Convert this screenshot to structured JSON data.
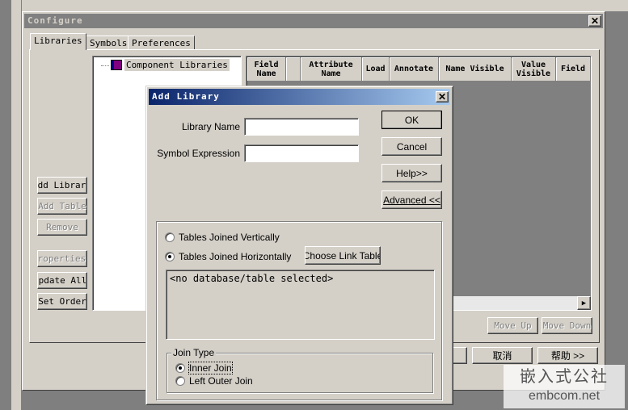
{
  "configure": {
    "title": "Configure",
    "close_glyph": "✕",
    "tabs": [
      "Libraries",
      "Symbols",
      "Preferences"
    ],
    "tree_root": "Component Libraries",
    "left_buttons": [
      "Add Library",
      "Add Table",
      "Remove",
      "Properties",
      "Update All",
      "Set Order"
    ],
    "columns": [
      "Field Name",
      "Attribute Name",
      "Load",
      "Annotate",
      "Name Visible",
      "Value Visible",
      "Field"
    ],
    "move_up": "Move Up",
    "move_down": "Move Down",
    "bottom_buttons": [
      "取消",
      "帮助 >>"
    ],
    "scroll_right_glyph": "▶"
  },
  "add_library": {
    "title": "Add Library",
    "close_glyph": "✕",
    "library_name_label": "Library Name",
    "library_name_value": "",
    "symbol_expression_label": "Symbol Expression",
    "symbol_expression_value": "",
    "ok": "OK",
    "cancel": "Cancel",
    "help": "Help>>",
    "advanced": "Advanced <<",
    "radio_vertical": "Tables Joined Vertically",
    "radio_horizontal": "Tables Joined Horizontally",
    "choose_link_table": "Choose Link Table",
    "link_text": "<no database/table selected>",
    "join_type_label": "Join Type",
    "inner_join": "Inner Join",
    "left_outer_join": "Left Outer Join"
  },
  "watermark": {
    "line1": "嵌入式公社",
    "line2": "embcom.net"
  }
}
